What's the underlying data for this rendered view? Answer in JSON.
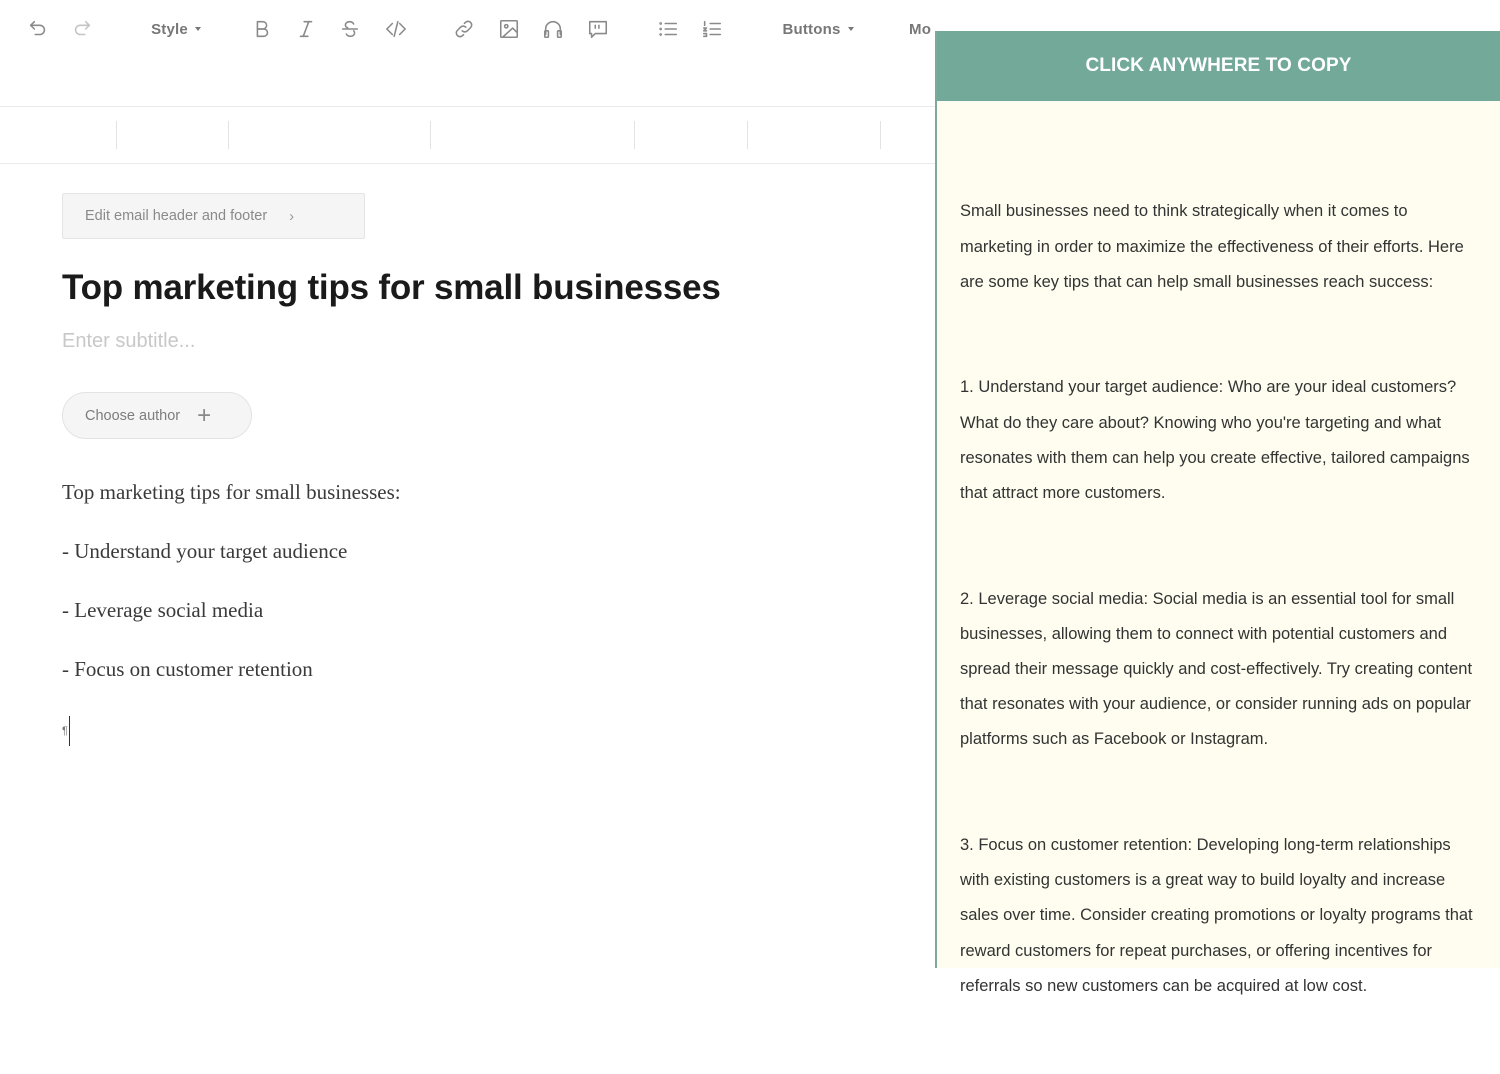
{
  "toolbar": {
    "style_label": "Style",
    "buttons_label": "Buttons",
    "more_label": "Mo",
    "icons": {
      "undo": "undo-icon",
      "redo": "redo-icon",
      "bold": "bold-icon",
      "italic": "italic-icon",
      "strikethrough": "strikethrough-icon",
      "code": "code-icon",
      "link": "link-icon",
      "image": "image-icon",
      "audio": "headphones-icon",
      "quote": "quote-icon",
      "bulleted_list": "bulleted-list-icon",
      "numbered_list": "numbered-list-icon"
    }
  },
  "editor": {
    "header_footer_label": "Edit email header and footer",
    "title": "Top marketing tips for small businesses",
    "subtitle_placeholder": "Enter subtitle...",
    "author_label": "Choose author",
    "body_lines": [
      "Top marketing tips for small businesses:",
      "- Understand your target audience",
      "- Leverage social media",
      "- Focus on customer retention"
    ],
    "cursor_mark": "¶"
  },
  "copy_panel": {
    "header": "CLICK ANYWHERE TO COPY",
    "paragraphs": [
      "Small businesses need to think strategically when it comes to marketing in order to maximize the effectiveness of their efforts. Here are some key tips that can help small businesses reach success:",
      "1. Understand your target audience: Who are your ideal customers? What do they care about? Knowing who you're targeting and what resonates with them can help you create effective, tailored campaigns that attract more customers.",
      "2. Leverage social media: Social media is an essential tool for small businesses, allowing them to connect with potential customers and spread their message quickly and cost-effectively. Try creating content that resonates with your audience, or consider running ads on popular platforms such as Facebook or Instagram.",
      "3. Focus on customer retention: Developing long-term relationships with existing customers is a great way to build loyalty and increase sales over time. Consider creating promotions or loyalty programs that reward customers for repeat purchases, or offering incentives for referrals so new customers can be acquired at low cost."
    ],
    "colors": {
      "header_bg": "#73a998",
      "panel_bg": "#fefdef"
    }
  }
}
